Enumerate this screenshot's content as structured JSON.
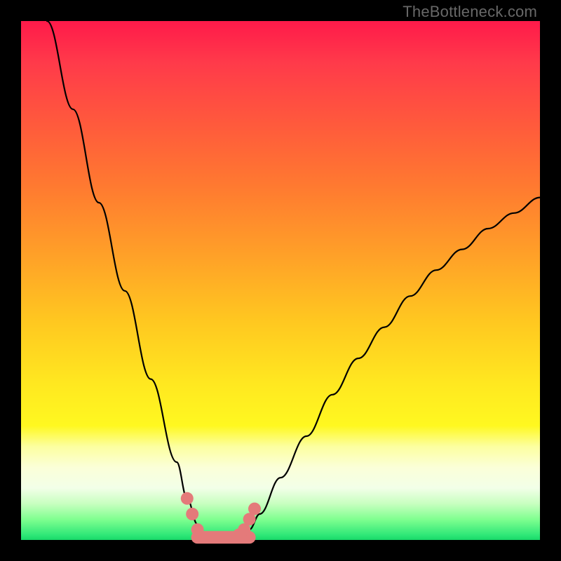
{
  "watermark": "TheBottleneck.com",
  "colors": {
    "frame": "#000000",
    "gradient_top": "#ff1a4a",
    "gradient_bottom": "#18d868",
    "curve": "#000000",
    "markers": "#e47a7a"
  },
  "chart_data": {
    "type": "line",
    "title": "",
    "xlabel": "",
    "ylabel": "",
    "xlim": [
      0,
      100
    ],
    "ylim": [
      0,
      100
    ],
    "series": [
      {
        "name": "bottleneck_curve",
        "x": [
          5,
          10,
          15,
          20,
          25,
          30,
          32,
          34,
          36,
          38,
          40,
          42,
          44,
          46,
          50,
          55,
          60,
          65,
          70,
          75,
          80,
          85,
          90,
          95,
          100
        ],
        "values": [
          100,
          83,
          65,
          48,
          31,
          15,
          8,
          3,
          0,
          0,
          0,
          0,
          2,
          5,
          12,
          20,
          28,
          35,
          41,
          47,
          52,
          56,
          60,
          63,
          66
        ]
      }
    ],
    "annotations": {
      "optimum_range_x": [
        34,
        44
      ],
      "marker_points": [
        {
          "x": 32,
          "y": 8
        },
        {
          "x": 33,
          "y": 5
        },
        {
          "x": 34,
          "y": 2
        },
        {
          "x": 42,
          "y": 1
        },
        {
          "x": 43,
          "y": 2
        },
        {
          "x": 44,
          "y": 4
        },
        {
          "x": 45,
          "y": 6
        }
      ]
    }
  }
}
